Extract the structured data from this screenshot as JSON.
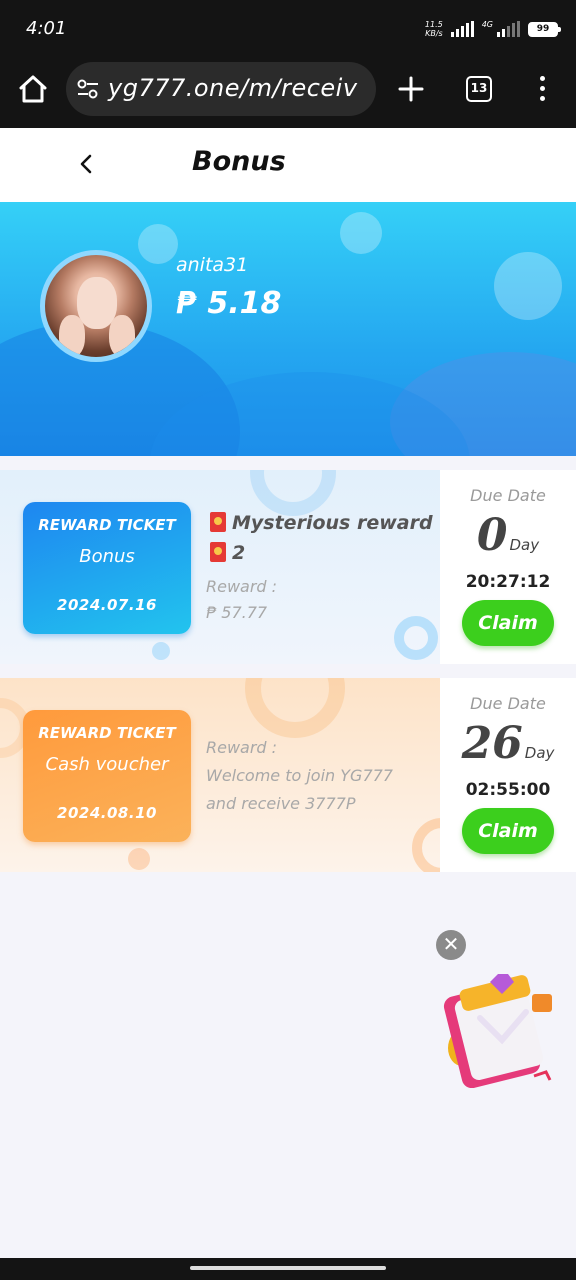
{
  "status_bar": {
    "time": "4:01",
    "net_speed_value": "11.5",
    "net_speed_unit": "KB/s",
    "network_label": "4G",
    "battery": "99"
  },
  "browser": {
    "url": "yg777.one/m/receiv",
    "tab_count": "13"
  },
  "header": {
    "title": "Bonus"
  },
  "profile": {
    "username": "anita31",
    "balance": "₱ 5.18"
  },
  "tickets": [
    {
      "badge_title": "REWARD TICKET",
      "badge_name": "Bonus",
      "badge_date": "2024.07.16",
      "lines": [
        "Mysterious reward",
        "2"
      ],
      "reward_label": "Reward :",
      "reward_value": "₱ 57.77",
      "due_label": "Due Date",
      "days": "0",
      "days_unit": "Day",
      "countdown": "20:27:12",
      "claim_label": "Claim"
    },
    {
      "badge_title": "REWARD TICKET",
      "badge_name": "Cash voucher",
      "badge_date": "2024.08.10",
      "reward_label": "Reward :",
      "reward_text_1": "Welcome to join YG777",
      "reward_text_2": "and receive 3777P",
      "due_label": "Due Date",
      "days": "26",
      "days_unit": "Day",
      "countdown": "02:55:00",
      "claim_label": "Claim"
    }
  ],
  "floating": {
    "close_symbol": "✕"
  },
  "colors": {
    "banner_blue": "#24a6f0",
    "claim_green": "#3ccf1d",
    "ticket_blue": "#1e86f0",
    "ticket_orange": "#ff9a3c"
  }
}
